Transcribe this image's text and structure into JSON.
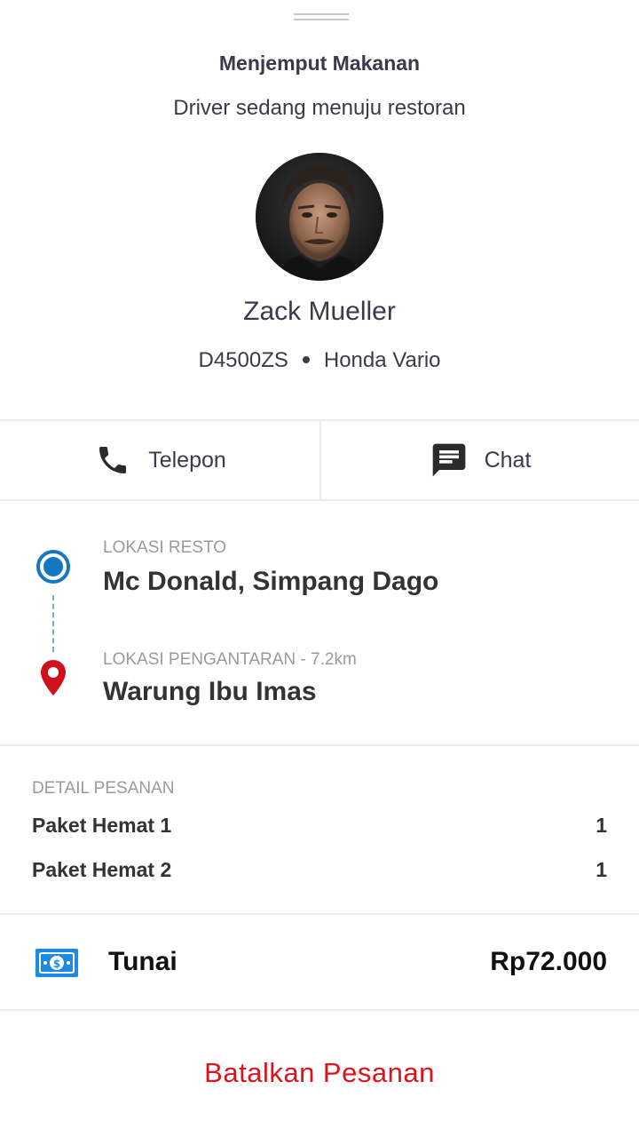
{
  "status": {
    "title": "Menjemput Makanan",
    "subtitle": "Driver sedang menuju restoran"
  },
  "driver": {
    "name": "Zack Mueller",
    "plate": "D4500ZS",
    "vehicle": "Honda Vario",
    "avatar_icon": "driver-photo"
  },
  "actions": {
    "call_label": "Telepon",
    "call_icon": "phone-icon",
    "chat_label": "Chat",
    "chat_icon": "chat-bubble-icon"
  },
  "route": {
    "origin_label": "LOKASI RESTO",
    "origin_value": "Mc Donald, Simpang Dago",
    "destination_label": "LOKASI PENGANTARAN - 7.2km",
    "destination_value": "Warung Ibu Imas"
  },
  "order": {
    "label": "DETAIL PESANAN",
    "items": [
      {
        "name": "Paket Hemat 1",
        "qty": "1"
      },
      {
        "name": "Paket Hemat 2",
        "qty": "1"
      }
    ]
  },
  "payment": {
    "method": "Tunai",
    "amount": "Rp72.000",
    "icon": "cash-icon"
  },
  "cancel_label": "Batalkan Pesanan",
  "colors": {
    "accent_blue": "#1577c4",
    "pin_red": "#d0111b",
    "cancel_red": "#e0121b",
    "cash_blue": "#1e8be0"
  }
}
